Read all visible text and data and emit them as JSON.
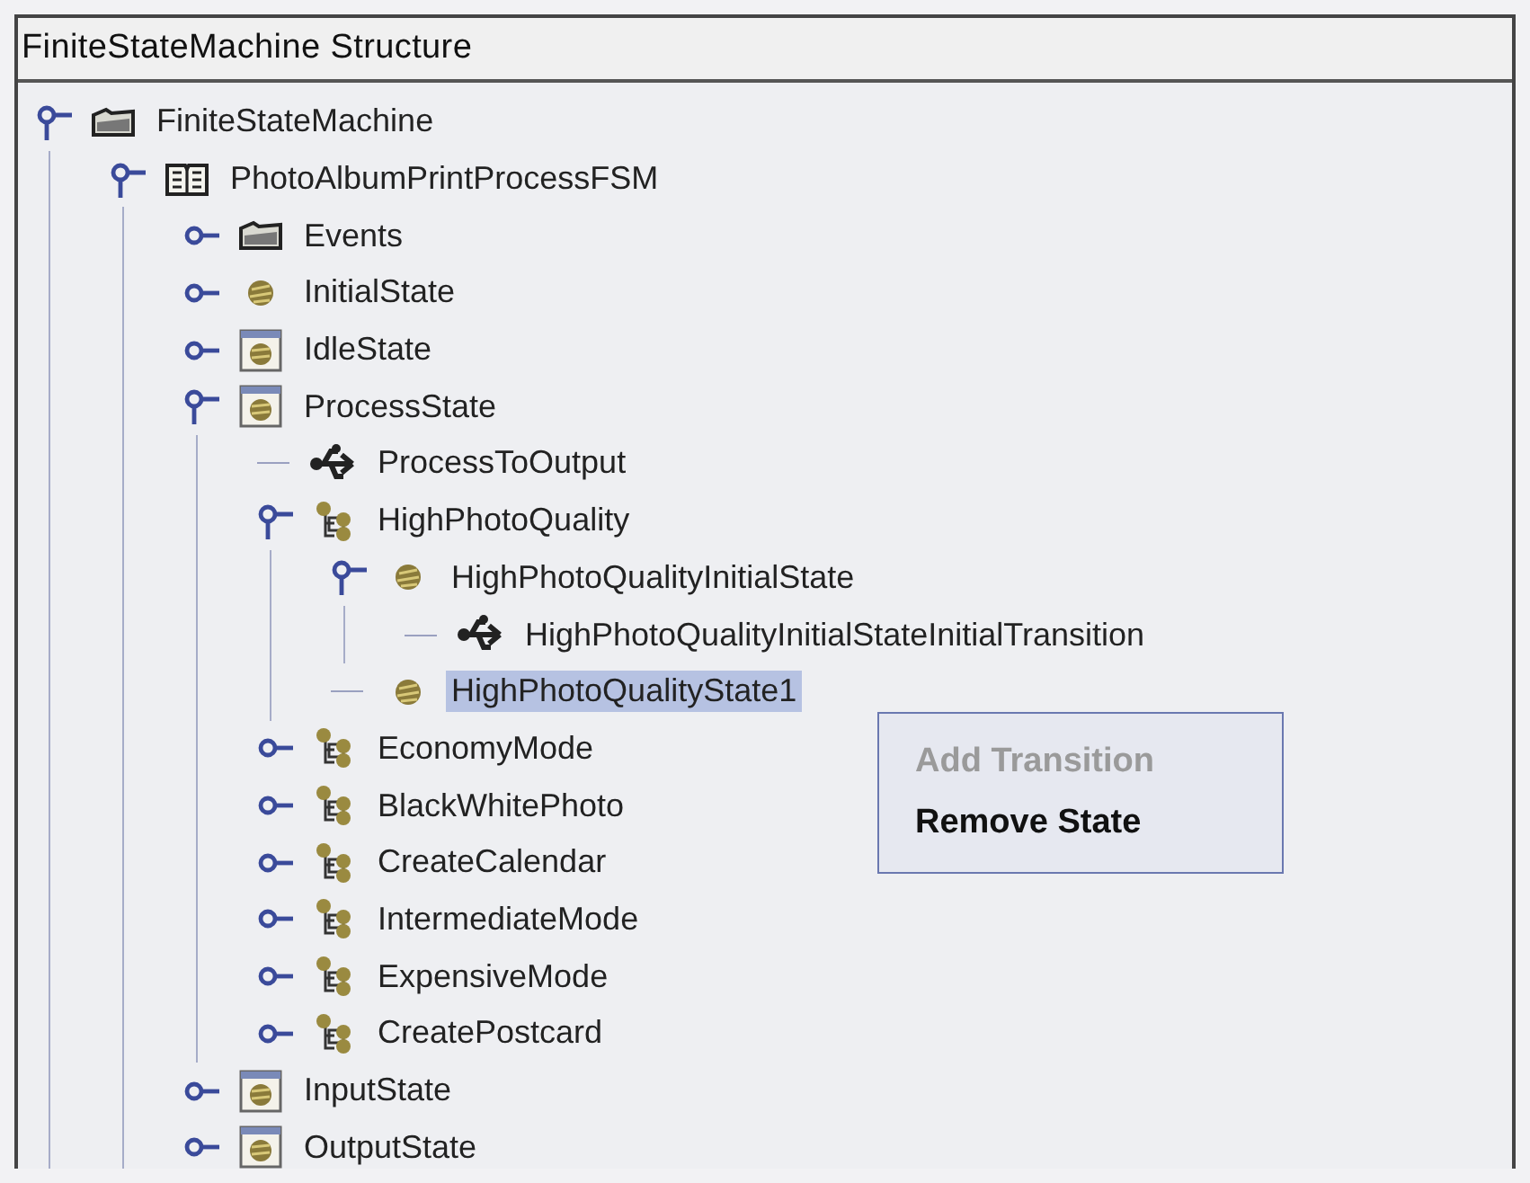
{
  "panel": {
    "title": "FiniteStateMachine Structure"
  },
  "tree": [
    {
      "label": "FiniteStateMachine",
      "kind": "folder",
      "expanded": true,
      "selected": false,
      "children": [
        {
          "label": "PhotoAlbumPrintProcessFSM",
          "kind": "book",
          "expanded": true,
          "selected": false,
          "children": [
            {
              "label": "Events",
              "kind": "folder",
              "expanded": false,
              "selected": false
            },
            {
              "label": "InitialState",
              "kind": "state",
              "expanded": false,
              "selected": false
            },
            {
              "label": "IdleState",
              "kind": "composite",
              "expanded": false,
              "selected": false
            },
            {
              "label": "ProcessState",
              "kind": "composite",
              "expanded": true,
              "selected": false,
              "children": [
                {
                  "label": "ProcessToOutput",
                  "kind": "transition",
                  "selected": false
                },
                {
                  "label": "HighPhotoQuality",
                  "kind": "region",
                  "expanded": true,
                  "selected": false,
                  "children": [
                    {
                      "label": "HighPhotoQualityInitialState",
                      "kind": "state",
                      "expanded": true,
                      "selected": false,
                      "children": [
                        {
                          "label": "HighPhotoQualityInitialStateInitialTransition",
                          "kind": "transition",
                          "selected": false
                        }
                      ]
                    },
                    {
                      "label": "HighPhotoQualityState1",
                      "kind": "state",
                      "selected": true
                    }
                  ]
                },
                {
                  "label": "EconomyMode",
                  "kind": "region",
                  "expanded": false,
                  "selected": false
                },
                {
                  "label": "BlackWhitePhoto",
                  "kind": "region",
                  "expanded": false,
                  "selected": false
                },
                {
                  "label": "CreateCalendar",
                  "kind": "region",
                  "expanded": false,
                  "selected": false
                },
                {
                  "label": "IntermediateMode",
                  "kind": "region",
                  "expanded": false,
                  "selected": false
                },
                {
                  "label": "ExpensiveMode",
                  "kind": "region",
                  "expanded": false,
                  "selected": false
                },
                {
                  "label": "CreatePostcard",
                  "kind": "region",
                  "expanded": false,
                  "selected": false
                }
              ]
            },
            {
              "label": "InputState",
              "kind": "composite",
              "expanded": false,
              "selected": false
            },
            {
              "label": "OutputState",
              "kind": "composite",
              "expanded": false,
              "selected": false
            }
          ]
        }
      ]
    }
  ],
  "context_menu": {
    "items": [
      {
        "label": "Add Transition",
        "disabled": true
      },
      {
        "label": "Remove State",
        "disabled": false
      }
    ]
  }
}
